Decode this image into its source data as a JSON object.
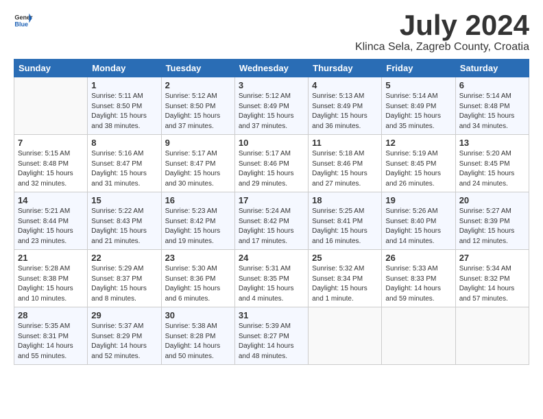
{
  "header": {
    "logo_general": "General",
    "logo_blue": "Blue",
    "month_title": "July 2024",
    "location": "Klinca Sela, Zagreb County, Croatia"
  },
  "weekdays": [
    "Sunday",
    "Monday",
    "Tuesday",
    "Wednesday",
    "Thursday",
    "Friday",
    "Saturday"
  ],
  "weeks": [
    [
      {
        "day": "",
        "info": ""
      },
      {
        "day": "1",
        "info": "Sunrise: 5:11 AM\nSunset: 8:50 PM\nDaylight: 15 hours\nand 38 minutes."
      },
      {
        "day": "2",
        "info": "Sunrise: 5:12 AM\nSunset: 8:50 PM\nDaylight: 15 hours\nand 37 minutes."
      },
      {
        "day": "3",
        "info": "Sunrise: 5:12 AM\nSunset: 8:49 PM\nDaylight: 15 hours\nand 37 minutes."
      },
      {
        "day": "4",
        "info": "Sunrise: 5:13 AM\nSunset: 8:49 PM\nDaylight: 15 hours\nand 36 minutes."
      },
      {
        "day": "5",
        "info": "Sunrise: 5:14 AM\nSunset: 8:49 PM\nDaylight: 15 hours\nand 35 minutes."
      },
      {
        "day": "6",
        "info": "Sunrise: 5:14 AM\nSunset: 8:48 PM\nDaylight: 15 hours\nand 34 minutes."
      }
    ],
    [
      {
        "day": "7",
        "info": "Sunrise: 5:15 AM\nSunset: 8:48 PM\nDaylight: 15 hours\nand 32 minutes."
      },
      {
        "day": "8",
        "info": "Sunrise: 5:16 AM\nSunset: 8:47 PM\nDaylight: 15 hours\nand 31 minutes."
      },
      {
        "day": "9",
        "info": "Sunrise: 5:17 AM\nSunset: 8:47 PM\nDaylight: 15 hours\nand 30 minutes."
      },
      {
        "day": "10",
        "info": "Sunrise: 5:17 AM\nSunset: 8:46 PM\nDaylight: 15 hours\nand 29 minutes."
      },
      {
        "day": "11",
        "info": "Sunrise: 5:18 AM\nSunset: 8:46 PM\nDaylight: 15 hours\nand 27 minutes."
      },
      {
        "day": "12",
        "info": "Sunrise: 5:19 AM\nSunset: 8:45 PM\nDaylight: 15 hours\nand 26 minutes."
      },
      {
        "day": "13",
        "info": "Sunrise: 5:20 AM\nSunset: 8:45 PM\nDaylight: 15 hours\nand 24 minutes."
      }
    ],
    [
      {
        "day": "14",
        "info": "Sunrise: 5:21 AM\nSunset: 8:44 PM\nDaylight: 15 hours\nand 23 minutes."
      },
      {
        "day": "15",
        "info": "Sunrise: 5:22 AM\nSunset: 8:43 PM\nDaylight: 15 hours\nand 21 minutes."
      },
      {
        "day": "16",
        "info": "Sunrise: 5:23 AM\nSunset: 8:42 PM\nDaylight: 15 hours\nand 19 minutes."
      },
      {
        "day": "17",
        "info": "Sunrise: 5:24 AM\nSunset: 8:42 PM\nDaylight: 15 hours\nand 17 minutes."
      },
      {
        "day": "18",
        "info": "Sunrise: 5:25 AM\nSunset: 8:41 PM\nDaylight: 15 hours\nand 16 minutes."
      },
      {
        "day": "19",
        "info": "Sunrise: 5:26 AM\nSunset: 8:40 PM\nDaylight: 15 hours\nand 14 minutes."
      },
      {
        "day": "20",
        "info": "Sunrise: 5:27 AM\nSunset: 8:39 PM\nDaylight: 15 hours\nand 12 minutes."
      }
    ],
    [
      {
        "day": "21",
        "info": "Sunrise: 5:28 AM\nSunset: 8:38 PM\nDaylight: 15 hours\nand 10 minutes."
      },
      {
        "day": "22",
        "info": "Sunrise: 5:29 AM\nSunset: 8:37 PM\nDaylight: 15 hours\nand 8 minutes."
      },
      {
        "day": "23",
        "info": "Sunrise: 5:30 AM\nSunset: 8:36 PM\nDaylight: 15 hours\nand 6 minutes."
      },
      {
        "day": "24",
        "info": "Sunrise: 5:31 AM\nSunset: 8:35 PM\nDaylight: 15 hours\nand 4 minutes."
      },
      {
        "day": "25",
        "info": "Sunrise: 5:32 AM\nSunset: 8:34 PM\nDaylight: 15 hours\nand 1 minute."
      },
      {
        "day": "26",
        "info": "Sunrise: 5:33 AM\nSunset: 8:33 PM\nDaylight: 14 hours\nand 59 minutes."
      },
      {
        "day": "27",
        "info": "Sunrise: 5:34 AM\nSunset: 8:32 PM\nDaylight: 14 hours\nand 57 minutes."
      }
    ],
    [
      {
        "day": "28",
        "info": "Sunrise: 5:35 AM\nSunset: 8:31 PM\nDaylight: 14 hours\nand 55 minutes."
      },
      {
        "day": "29",
        "info": "Sunrise: 5:37 AM\nSunset: 8:29 PM\nDaylight: 14 hours\nand 52 minutes."
      },
      {
        "day": "30",
        "info": "Sunrise: 5:38 AM\nSunset: 8:28 PM\nDaylight: 14 hours\nand 50 minutes."
      },
      {
        "day": "31",
        "info": "Sunrise: 5:39 AM\nSunset: 8:27 PM\nDaylight: 14 hours\nand 48 minutes."
      },
      {
        "day": "",
        "info": ""
      },
      {
        "day": "",
        "info": ""
      },
      {
        "day": "",
        "info": ""
      }
    ]
  ]
}
